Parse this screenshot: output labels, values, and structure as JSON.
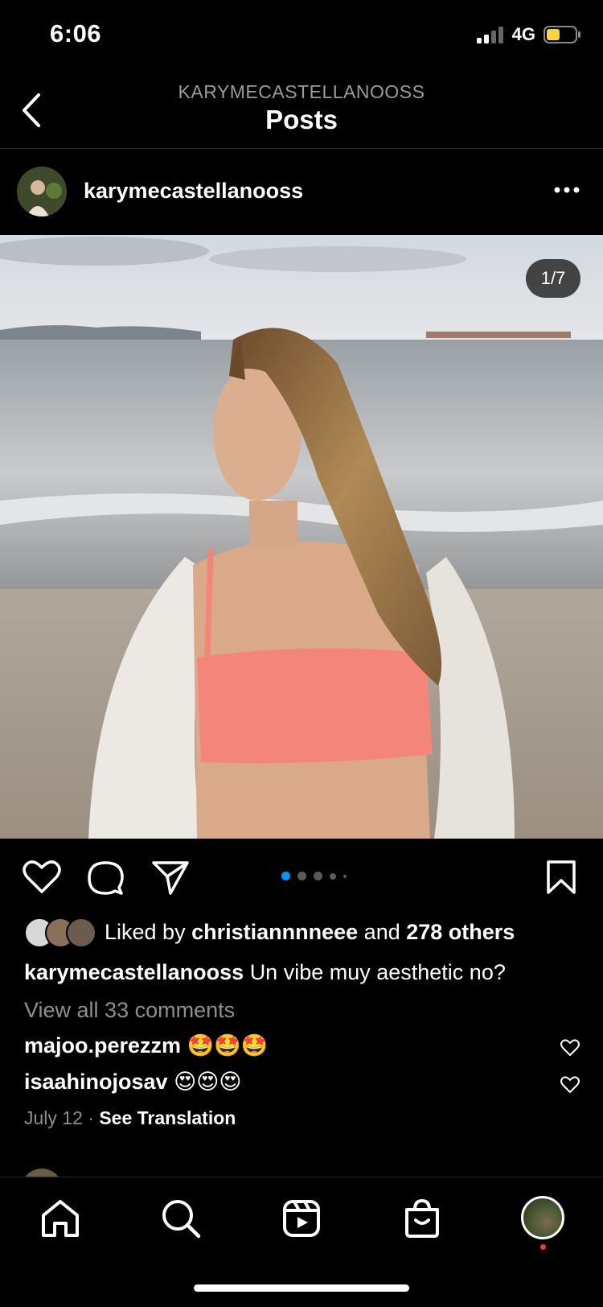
{
  "status_bar": {
    "time": "6:06",
    "network": "4G",
    "battery_color": "#f5d547"
  },
  "header": {
    "username": "KARYMECASTELLANOOSS",
    "title": "Posts"
  },
  "post": {
    "username": "karymecastellanooss",
    "image_counter": "1/7",
    "carousel": {
      "total_dots": 5,
      "active_index": 0
    },
    "likes": {
      "prefix": "Liked by",
      "user": "christiannnneee",
      "middle": "and",
      "others": "278 others"
    },
    "caption": {
      "username": "karymecastellanooss",
      "text": "Un vibe muy aesthetic no?"
    },
    "view_all_comments": "View all 33 comments",
    "comments": [
      {
        "username": "majoo.perezzm",
        "text": "🤩🤩🤩"
      },
      {
        "username": "isaahinojosav",
        "text": "😍😍😍"
      }
    ],
    "date": "July 12",
    "separator": "·",
    "see_translation": "See Translation"
  },
  "nav": {
    "items": [
      "home-icon",
      "search-icon",
      "reels-icon",
      "shop-icon",
      "profile-avatar"
    ],
    "notification_color": "#ff3040"
  },
  "colors": {
    "accent": "#0095f6",
    "muted": "#8e8e8e",
    "background": "#000000"
  }
}
